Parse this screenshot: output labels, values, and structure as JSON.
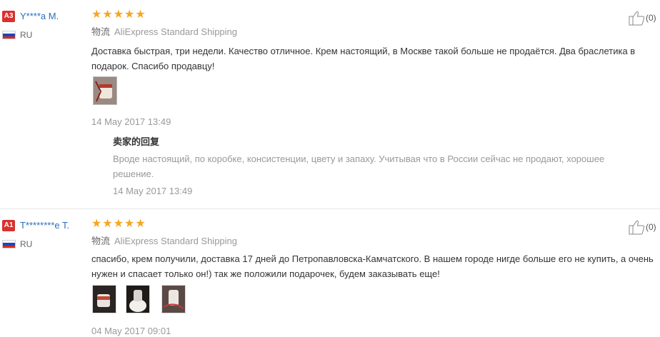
{
  "reviews": [
    {
      "badge": "A3",
      "name": "Y****a M.",
      "country": "RU",
      "stars": "★★★★★",
      "ship_cn": "物流",
      "shipping": "AliExpress Standard Shipping",
      "text": "Доставка быстрая, три недели. Качество отличное. Крем настоящий, в Москве такой больше не продаётся. Два браслетика в подарок. Спасибо продавцу!",
      "date": "14 May 2017 13:49",
      "likes": "(0)",
      "photos": 1,
      "reply": {
        "title": "卖家的回复",
        "text": "Вроде настоящий, по коробке, консистенции, цвету и запаху. Учитывая что в России сейчас не продают, хорошее решение.",
        "date": "14 May 2017 13:49"
      }
    },
    {
      "badge": "A1",
      "name": "T********e T.",
      "country": "RU",
      "stars": "★★★★★",
      "ship_cn": "物流",
      "shipping": "AliExpress Standard Shipping",
      "text": "спасибо, крем получили, доставка 17 дней до Петропавловска-Камчатского. В нашем городе нигде больше его не купить, а очень нужен и спасает только он!) так же положили подарочек, будем заказывать еще!",
      "date": "04 May 2017 09:01",
      "likes": "(0)",
      "photos": 3
    }
  ],
  "colors": {
    "star": "#f5a623",
    "badge": "#d8322e",
    "name": "#2a6ebd",
    "flag": [
      "#ffffff",
      "#1c47b8",
      "#d52b1e"
    ]
  },
  "icons": {
    "like": "thumbs-up-icon",
    "flag": "russia-flag-icon"
  }
}
